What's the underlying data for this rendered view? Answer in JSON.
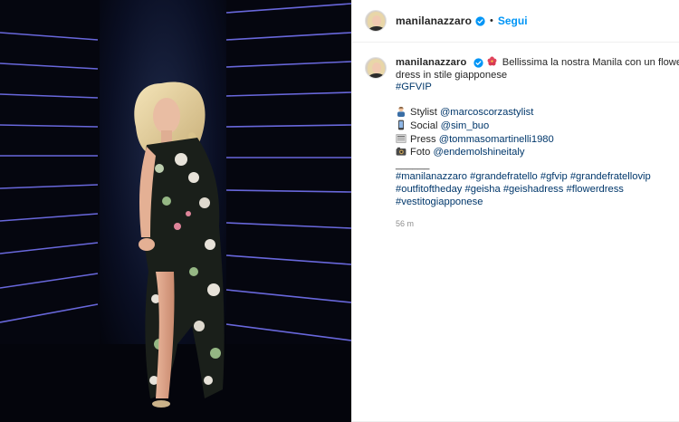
{
  "post": {
    "image_alt": "",
    "username": "manilanazzaro",
    "dot": "•",
    "follow_label": "Segui"
  },
  "caption": {
    "username": "manilanazzaro",
    "text_line1": "Bellissima la nostra Manila con un flower",
    "text_line2": "dress in stile giapponese",
    "hashtag_gfvip": "#GFVIP",
    "credits": [
      {
        "icon": "person-emoji",
        "label": "Stylist",
        "handle": "@marcoscorzastylist"
      },
      {
        "icon": "speech-emoji",
        "label": "Social",
        "handle": "@sim_buo"
      },
      {
        "icon": "newspaper-emoji",
        "label": "Press",
        "handle": "@tommasomartinelli1980"
      },
      {
        "icon": "camera-emoji",
        "label": "Foto",
        "handle": "@endemolshineitaly"
      }
    ],
    "divider": "______",
    "hashtags_line1": [
      "#manilanazzaro",
      "#grandefratello",
      "#gfvip",
      "#grandefratellovip"
    ],
    "hashtags_line2": [
      "#outfitoftheday",
      "#geisha",
      "#geishadress",
      "#flowerdress"
    ],
    "hashtags_line3": [
      "#vestitogiapponese"
    ],
    "time_ago": "56 m"
  },
  "colors": {
    "accent": "#0095f6",
    "link": "#00376b",
    "muted": "#8e8e8e",
    "stage_bg": "#05060f",
    "stage_lights": "#6b6bff"
  }
}
